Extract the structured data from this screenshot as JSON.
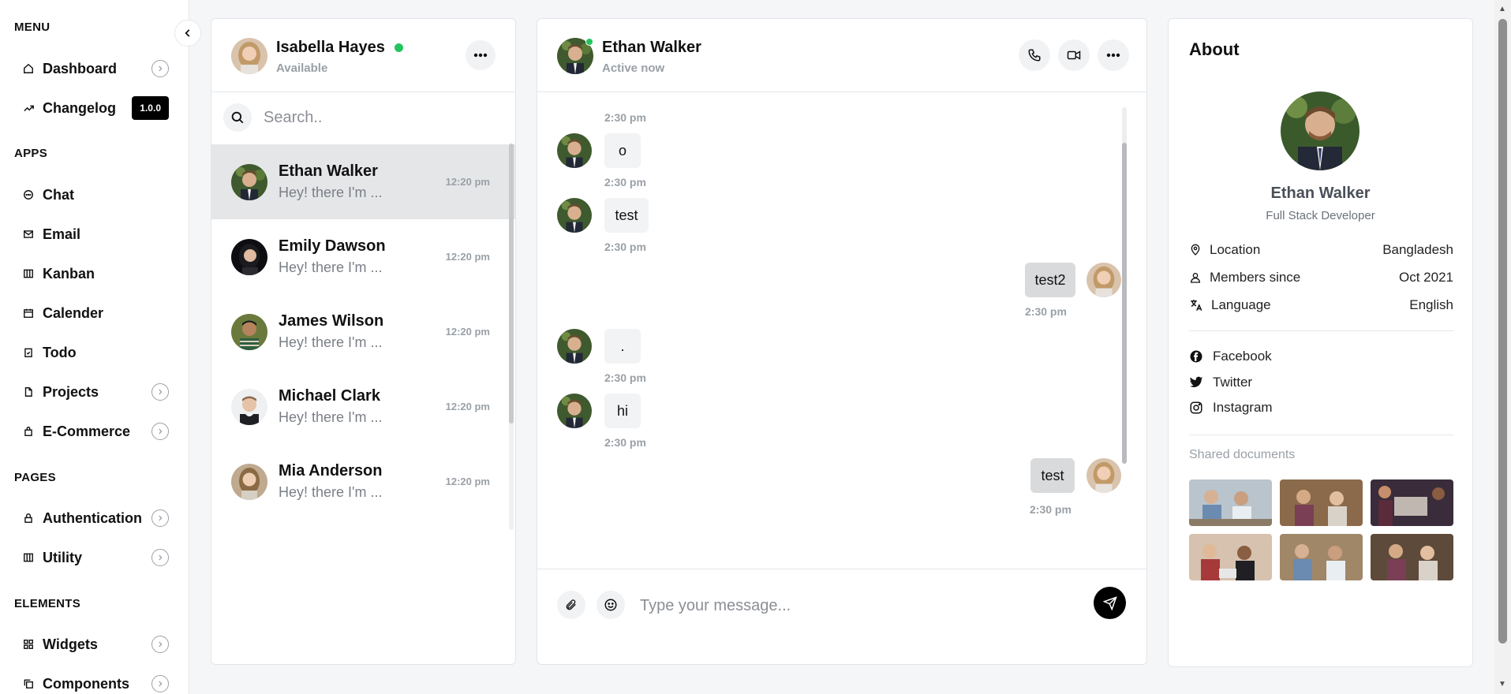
{
  "sidebar": {
    "sections": {
      "menu": "MENU",
      "apps": "APPS",
      "pages": "PAGES",
      "elements": "ELEMENTS"
    },
    "items": {
      "dashboard": {
        "label": "Dashboard",
        "icon": "home-icon"
      },
      "changelog": {
        "label": "Changelog",
        "icon": "trending-up-icon",
        "badge": "1.0.0"
      },
      "chat": {
        "label": "Chat",
        "icon": "chat-bubble-icon"
      },
      "email": {
        "label": "Email",
        "icon": "mail-icon"
      },
      "kanban": {
        "label": "Kanban",
        "icon": "columns-icon"
      },
      "calender": {
        "label": "Calender",
        "icon": "calendar-icon"
      },
      "todo": {
        "label": "Todo",
        "icon": "clipboard-check-icon"
      },
      "projects": {
        "label": "Projects",
        "icon": "file-icon"
      },
      "ecommerce": {
        "label": "E-Commerce",
        "icon": "bag-icon"
      },
      "authentication": {
        "label": "Authentication",
        "icon": "lock-icon"
      },
      "utility": {
        "label": "Utility",
        "icon": "columns-icon"
      },
      "widgets": {
        "label": "Widgets",
        "icon": "grid-icon"
      },
      "components": {
        "label": "Components",
        "icon": "copy-icon"
      }
    }
  },
  "contacts_panel": {
    "me": {
      "name": "Isabella Hayes",
      "status": "Available",
      "status_color": "#22c55e"
    },
    "search_placeholder": "Search..",
    "contacts": [
      {
        "name": "Ethan Walker",
        "preview": "Hey! there I'm ...",
        "time": "12:20 pm",
        "active": true
      },
      {
        "name": "Emily Dawson",
        "preview": "Hey! there I'm ...",
        "time": "12:20 pm"
      },
      {
        "name": "James Wilson",
        "preview": "Hey! there I'm ...",
        "time": "12:20 pm"
      },
      {
        "name": "Michael Clark",
        "preview": "Hey! there I'm ...",
        "time": "12:20 pm"
      },
      {
        "name": "Mia Anderson",
        "preview": "Hey! there I'm ...",
        "time": "12:20 pm"
      }
    ]
  },
  "chat_panel": {
    "contact_name": "Ethan Walker",
    "contact_status": "Active now",
    "messages": [
      {
        "direction": "in",
        "text": "o",
        "time": "2:30 pm"
      },
      {
        "direction": "in",
        "text": "test",
        "time": "2:30 pm"
      },
      {
        "direction": "out",
        "text": "test2",
        "time": "2:30 pm"
      },
      {
        "direction": "in",
        "text": ".",
        "time": "2:30 pm"
      },
      {
        "direction": "in",
        "text": "hi",
        "time": "2:30 pm"
      },
      {
        "direction": "out",
        "text": "test",
        "time": "2:30 pm"
      }
    ],
    "top_time": "2:30 pm",
    "input_placeholder": "Type your message..."
  },
  "about_panel": {
    "title": "About",
    "name": "Ethan Walker",
    "role": "Full Stack Developer",
    "location_label": "Location",
    "location_value": "Bangladesh",
    "members_label": "Members since",
    "members_value": "Oct 2021",
    "language_label": "Language",
    "language_value": "English",
    "social": {
      "facebook": "Facebook",
      "twitter": "Twitter",
      "instagram": "Instagram"
    },
    "shared_title": "Shared documents"
  }
}
